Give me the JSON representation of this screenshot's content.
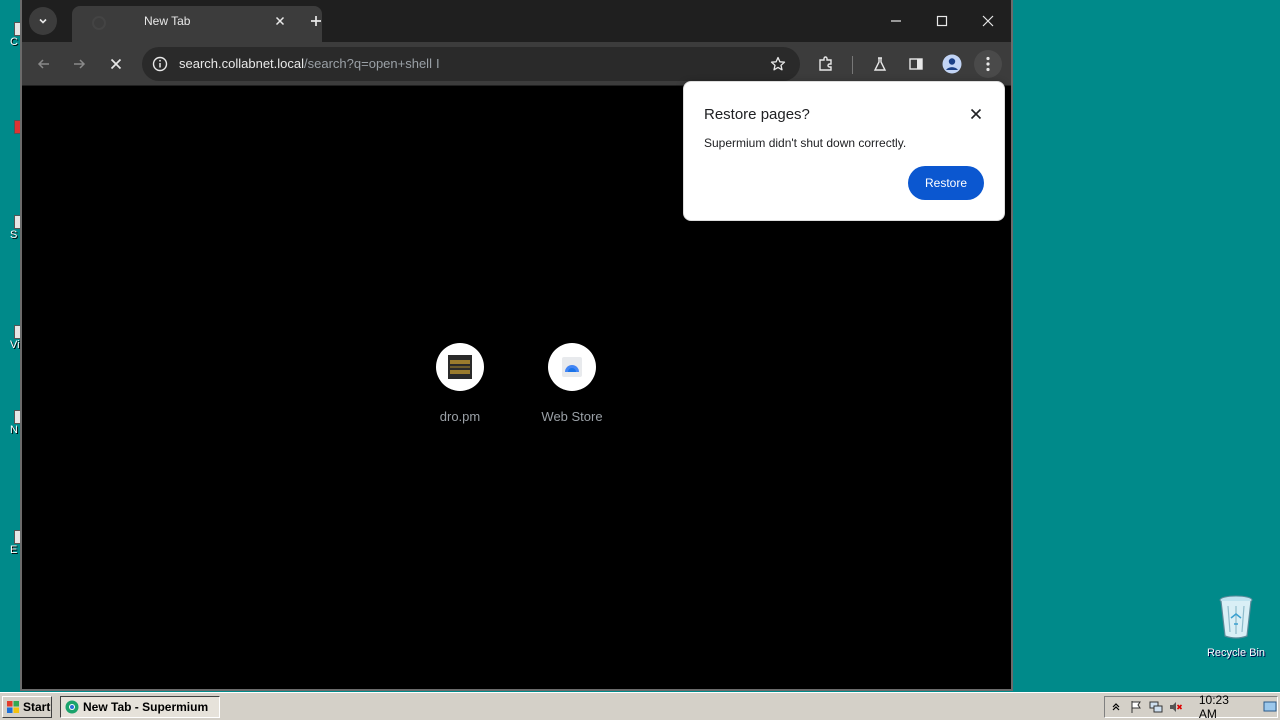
{
  "desktop": {
    "left_fragments": [
      "C",
      "S",
      "Vi",
      "N",
      "E"
    ],
    "recycle_bin_label": "Recycle Bin"
  },
  "browser": {
    "tab": {
      "title": "New Tab"
    },
    "address": {
      "host": "search.collabnet.local",
      "path": "/search?q=open+shell"
    },
    "shortcuts": [
      {
        "label": "dro.pm",
        "icon": "dro-pm-favicon"
      },
      {
        "label": "Web Store",
        "icon": "web-store-icon"
      }
    ],
    "restore_popup": {
      "title": "Restore pages?",
      "message": "Supermium didn't shut down correctly.",
      "button_label": "Restore"
    }
  },
  "taskbar": {
    "start_label": "Start",
    "window_item_label": "New Tab - Supermium",
    "clock": "10:23 AM"
  },
  "colors": {
    "desktop_bg": "#008a8a",
    "restore_button": "#0b57d0",
    "taskbar_bg": "#d4d0c8"
  }
}
